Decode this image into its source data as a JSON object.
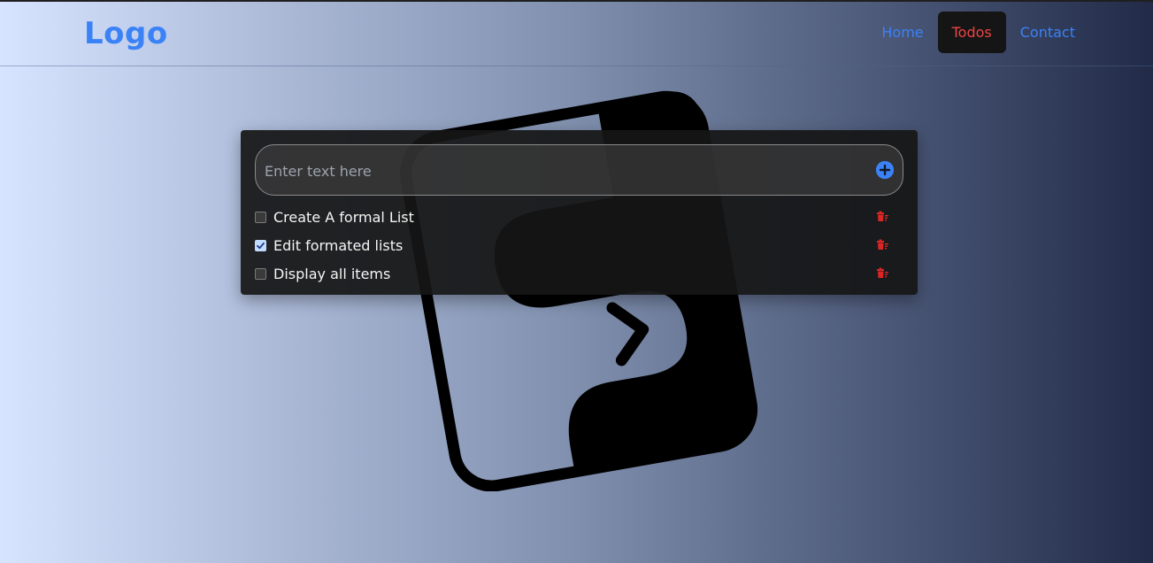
{
  "navbar": {
    "logo": "Logo",
    "links": [
      {
        "label": "Home",
        "active": false
      },
      {
        "label": "Todos",
        "active": true
      },
      {
        "label": "Contact",
        "active": false
      }
    ]
  },
  "todo": {
    "input": {
      "placeholder": "Enter text here",
      "value": ""
    },
    "add_icon": "plus-circle-icon",
    "items": [
      {
        "label": "Create A formal List",
        "checked": false
      },
      {
        "label": "Edit formated lists",
        "checked": true
      },
      {
        "label": "Display all items",
        "checked": false
      }
    ],
    "delete_icon": "trash-icon"
  },
  "colors": {
    "accent": "#3b82f6",
    "active_nav_text": "#ef4444",
    "active_nav_bg": "#151515",
    "delete": "#dc2626",
    "card_bg": "#161616",
    "checked_box": "#bfdbfe"
  },
  "background": {
    "emblem": "todo-app-logo-icon"
  }
}
